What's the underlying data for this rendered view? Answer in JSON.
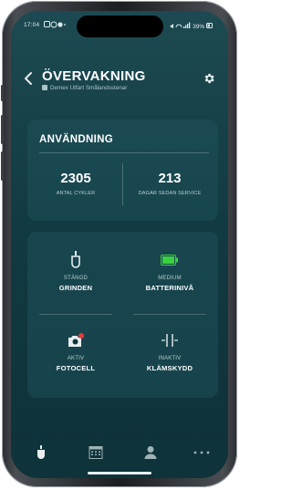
{
  "status_bar": {
    "time": "17:04",
    "right_text": "39%"
  },
  "header": {
    "title": "ÖVERVAKNING",
    "subtitle": "Demex Utfart Smålandsstenar"
  },
  "usage": {
    "title": "ANVÄNDNING",
    "cycles_value": "2305",
    "cycles_label": "ANTAL CYKLER",
    "days_value": "213",
    "days_label": "DAGAR SEDAN SERVICE"
  },
  "controls": {
    "gate": {
      "line1": "STÄNGD",
      "line2": "GRINDEN",
      "icon": "gate-icon"
    },
    "battery": {
      "line1": "MEDIUM",
      "line2": "BATTERINIVÅ",
      "icon": "battery-icon",
      "color": "#38d13f"
    },
    "photocell": {
      "line1": "AKTIV",
      "line2": "FOTOCELL",
      "icon": "camera-icon",
      "alert_color": "#e33b3b"
    },
    "pinch": {
      "line1": "INAKTIV",
      "line2": "KLÄMSKYDD",
      "icon": "pinch-guard-icon"
    }
  },
  "tabbar": {
    "tabs": [
      "gate-tab-icon",
      "calendar-tab-icon",
      "user-tab-icon",
      "more-tab-icon"
    ]
  },
  "colors": {
    "background": "#123a42",
    "card": "#1e505a"
  }
}
